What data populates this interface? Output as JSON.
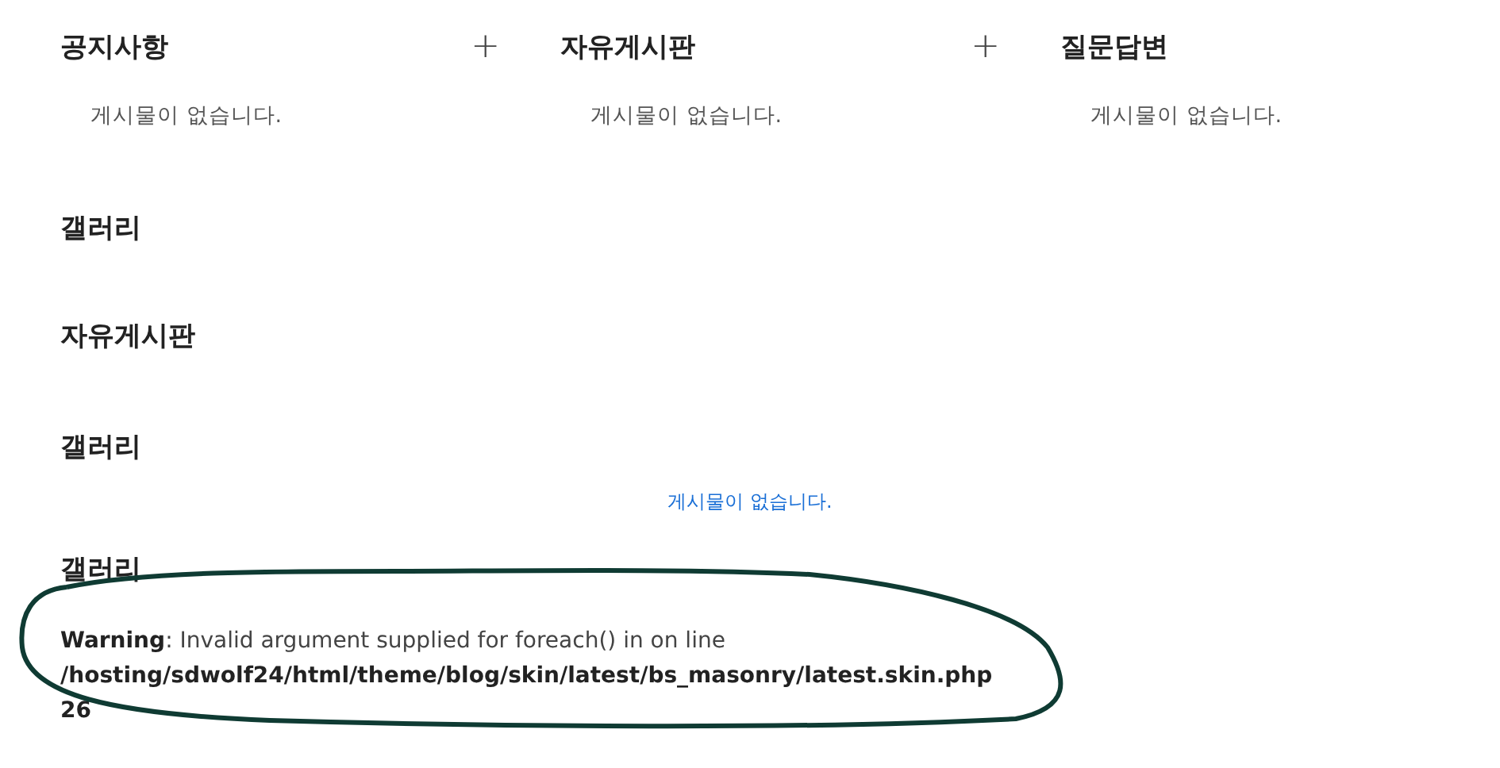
{
  "boards": [
    {
      "title": "공지사항",
      "add_icon": "+",
      "empty": "게시물이 없습니다."
    },
    {
      "title": "자유게시판",
      "add_icon": "+",
      "empty": "게시물이 없습니다."
    },
    {
      "title": "질문답변",
      "empty": "게시물이 없습니다."
    }
  ],
  "sections": [
    {
      "title": "갤러리"
    },
    {
      "title": "자유게시판"
    },
    {
      "title": "갤러리",
      "empty": "게시물이 없습니다."
    },
    {
      "title": "갤러리",
      "warning": {
        "label": "Warning",
        "message": ": Invalid argument supplied for foreach() in",
        "on_line": "on line",
        "path": "/hosting/sdwolf24/html/theme/blog/skin/latest/bs_masonry/latest.skin.php",
        "line": "26"
      }
    }
  ]
}
